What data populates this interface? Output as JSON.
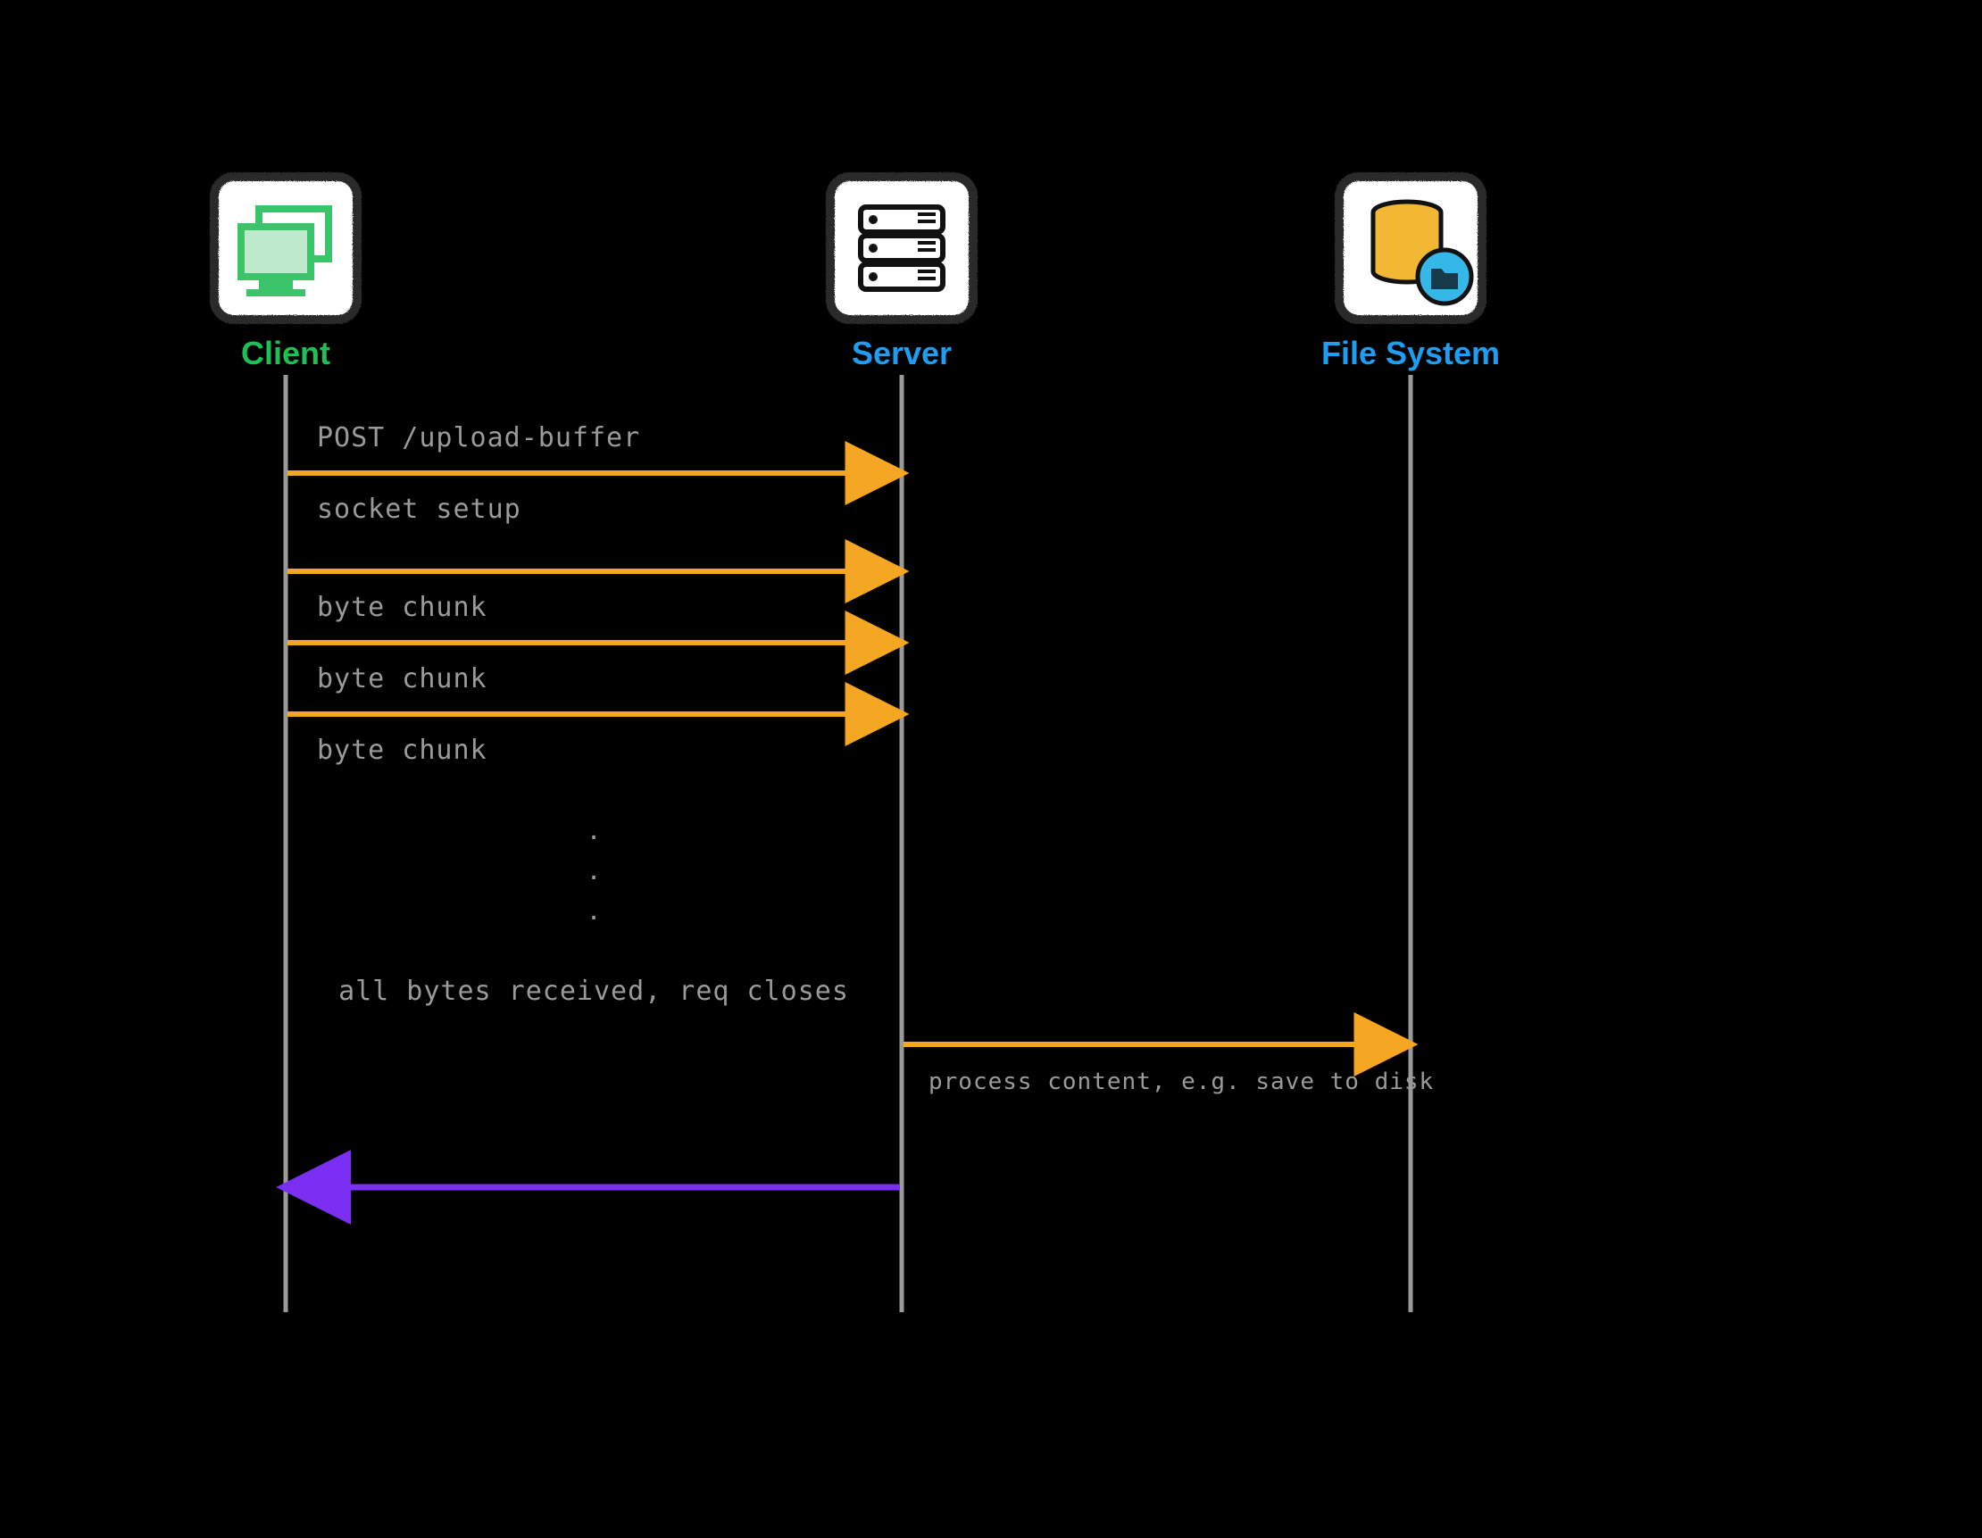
{
  "actors": {
    "client": {
      "label": "Client",
      "color": "#1fbf55"
    },
    "server": {
      "label": "Server",
      "color": "#1e9df1"
    },
    "filesystem": {
      "label": "File System",
      "color": "#1e9df1"
    }
  },
  "messages": {
    "m1": "POST /upload-buffer",
    "m2": "socket setup",
    "m3": "byte chunk",
    "m4": "byte chunk",
    "m5": "byte chunk",
    "gap": "all bytes received, req closes",
    "m6": "process content, e.g. save to disk"
  },
  "colors": {
    "arrow_request": "#f5a623",
    "arrow_response": "#7b2ff2",
    "lifeline": "#9a9a9a",
    "box_fill": "#ffffff",
    "text_muted": "#9a9a9a"
  },
  "chart_data": {
    "type": "sequence-diagram",
    "actors": [
      "Client",
      "Server",
      "File System"
    ],
    "events": [
      {
        "from": "Client",
        "to": "Server",
        "label": "POST /upload-buffer"
      },
      {
        "from": "Client",
        "to": "Server",
        "label": "socket setup"
      },
      {
        "from": "Client",
        "to": "Server",
        "label": "byte chunk"
      },
      {
        "from": "Client",
        "to": "Server",
        "label": "byte chunk"
      },
      {
        "from": "Client",
        "to": "Server",
        "label": "byte chunk"
      },
      {
        "note": "…",
        "at": "Client↔Server"
      },
      {
        "note": "all bytes received, req closes",
        "at": "Client↔Server"
      },
      {
        "from": "Server",
        "to": "File System",
        "label": "process content, e.g. save to disk"
      },
      {
        "from": "Server",
        "to": "Client",
        "label": "",
        "response": true
      }
    ]
  }
}
